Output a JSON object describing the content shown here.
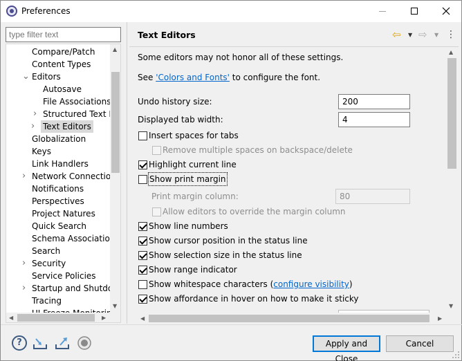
{
  "window": {
    "title": "Preferences",
    "controls": {
      "minimize": "—",
      "maximize": "☐",
      "close": "✕"
    }
  },
  "filter": {
    "placeholder": "type filter text"
  },
  "tree": {
    "items": [
      {
        "label": "Compare/Patch",
        "level": 1,
        "expander": ""
      },
      {
        "label": "Content Types",
        "level": 1,
        "expander": ""
      },
      {
        "label": "Editors",
        "level": 1,
        "expander": "expanded"
      },
      {
        "label": "Autosave",
        "level": 2,
        "expander": ""
      },
      {
        "label": "File Associations",
        "level": 2,
        "expander": ""
      },
      {
        "label": "Structured Text Ed",
        "level": 2,
        "expander": "collapsed"
      },
      {
        "label": "Text Editors",
        "level": 2,
        "expander": "collapsed",
        "selected": true
      },
      {
        "label": "Globalization",
        "level": 1,
        "expander": ""
      },
      {
        "label": "Keys",
        "level": 1,
        "expander": ""
      },
      {
        "label": "Link Handlers",
        "level": 1,
        "expander": ""
      },
      {
        "label": "Network Connection",
        "level": 1,
        "expander": "collapsed"
      },
      {
        "label": "Notifications",
        "level": 1,
        "expander": ""
      },
      {
        "label": "Perspectives",
        "level": 1,
        "expander": ""
      },
      {
        "label": "Project Natures",
        "level": 1,
        "expander": ""
      },
      {
        "label": "Quick Search",
        "level": 1,
        "expander": ""
      },
      {
        "label": "Schema Associations",
        "level": 1,
        "expander": ""
      },
      {
        "label": "Search",
        "level": 1,
        "expander": ""
      },
      {
        "label": "Security",
        "level": 1,
        "expander": "collapsed"
      },
      {
        "label": "Service Policies",
        "level": 1,
        "expander": ""
      },
      {
        "label": "Startup and Shutdow",
        "level": 1,
        "expander": "collapsed"
      },
      {
        "label": "Tracing",
        "level": 1,
        "expander": ""
      },
      {
        "label": "UI Freeze Monitoring",
        "level": 1,
        "expander": ""
      }
    ]
  },
  "page": {
    "title": "Text Editors",
    "nav": {
      "back": "⇦",
      "forward": "⇨",
      "dropdown": "▼",
      "menu": "⋮"
    },
    "notice": "Some editors may not honor all of these settings.",
    "see_prefix": "See ",
    "see_link": "'Colors and Fonts'",
    "see_suffix": " to configure the font.",
    "undo_label": "Undo history size:",
    "undo_value": "200",
    "tab_label": "Displayed tab width:",
    "tab_value": "4",
    "options": {
      "insert_spaces": {
        "label": "Insert spaces for tabs",
        "checked": false
      },
      "remove_multiple": {
        "label": "Remove multiple spaces on backspace/delete",
        "checked": false,
        "enabled": false
      },
      "highlight_line": {
        "label": "Highlight current line",
        "checked": true
      },
      "show_print_margin": {
        "label": "Show print margin",
        "checked": false
      },
      "print_margin_label": "Print margin column:",
      "print_margin_value": "80",
      "allow_override": {
        "label": "Allow editors to override the margin column",
        "checked": false,
        "enabled": false
      },
      "line_numbers": {
        "label": "Show line numbers",
        "checked": true
      },
      "cursor_position": {
        "label": "Show cursor position in the status line",
        "checked": true
      },
      "selection_size": {
        "label": "Show selection size in the status line",
        "checked": true
      },
      "range_indicator": {
        "label": "Show range indicator",
        "checked": true
      },
      "whitespace": {
        "label": "Show whitespace characters (",
        "link": "configure visibility",
        "suffix": ")",
        "checked": false
      },
      "affordance": {
        "label": "Show affordance in hover on how to make it sticky",
        "checked": true
      }
    }
  },
  "footer": {
    "help": "?",
    "apply_close": "Apply and Close",
    "cancel": "Cancel"
  },
  "colors": {
    "link": "#0066cc",
    "default_button_border": "#0078d7",
    "back_arrow": "#d8a520",
    "selection": "#d9d9d9"
  }
}
